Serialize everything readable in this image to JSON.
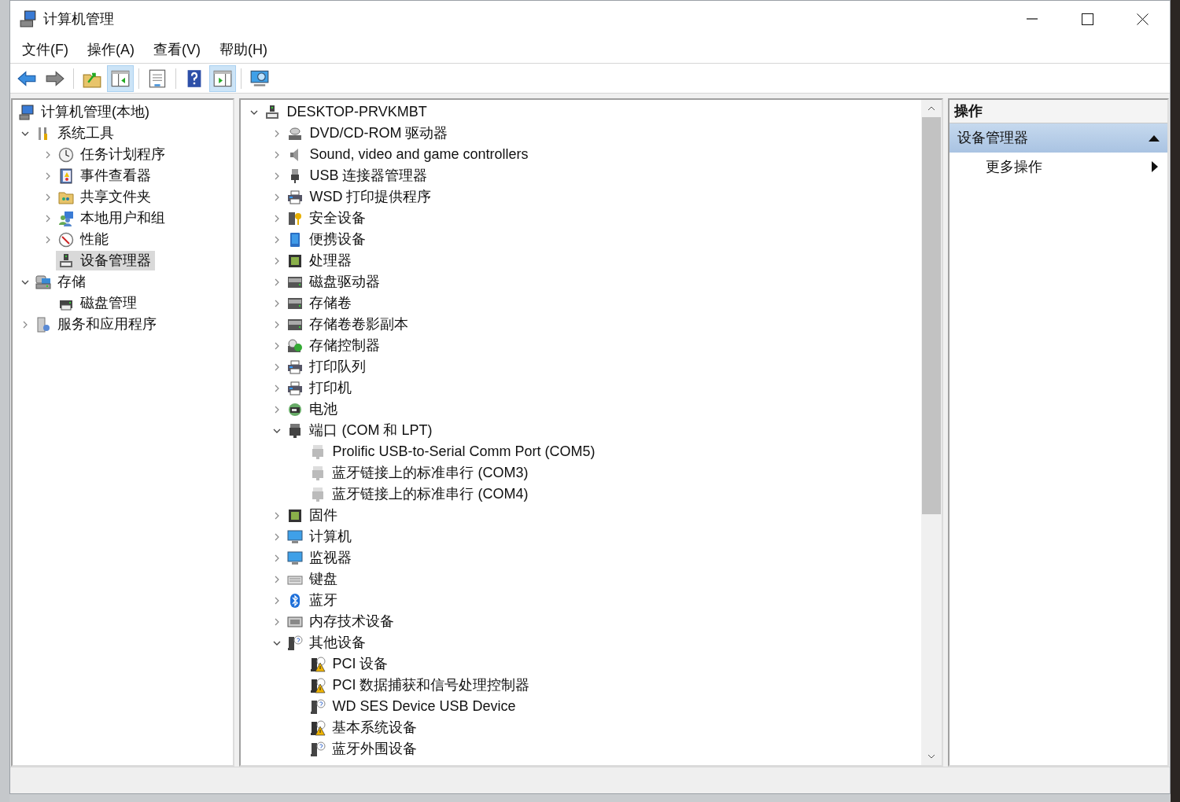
{
  "window": {
    "title": "计算机管理"
  },
  "menu": [
    "文件(F)",
    "操作(A)",
    "查看(V)",
    "帮助(H)"
  ],
  "toolbar": [
    {
      "kind": "back",
      "pressed": false
    },
    {
      "kind": "forward",
      "pressed": false
    },
    {
      "kind": "sep"
    },
    {
      "kind": "up",
      "pressed": false
    },
    {
      "kind": "tree",
      "pressed": true
    },
    {
      "kind": "sep"
    },
    {
      "kind": "props",
      "pressed": false
    },
    {
      "kind": "sep"
    },
    {
      "kind": "help",
      "pressed": false
    },
    {
      "kind": "actions",
      "pressed": true
    },
    {
      "kind": "sep"
    },
    {
      "kind": "monitor",
      "pressed": false
    }
  ],
  "console_tree": [
    {
      "label": "计算机管理(本地)",
      "kind": "computer",
      "selected": false,
      "children": [
        {
          "label": "系统工具",
          "kind": "tools",
          "expanded": true,
          "selected": false,
          "children": [
            {
              "label": "任务计划程序",
              "kind": "clock",
              "expanded": false,
              "selected": false
            },
            {
              "label": "事件查看器",
              "kind": "log",
              "expanded": false,
              "selected": false
            },
            {
              "label": "共享文件夹",
              "kind": "share",
              "expanded": false,
              "selected": false
            },
            {
              "label": "本地用户和组",
              "kind": "users",
              "expanded": false,
              "selected": false
            },
            {
              "label": "性能",
              "kind": "gauge",
              "expanded": false,
              "selected": false
            },
            {
              "label": "设备管理器",
              "kind": "devmgr",
              "selected": true
            }
          ]
        },
        {
          "label": "存储",
          "kind": "storage",
          "expanded": true,
          "selected": false,
          "children": [
            {
              "label": "磁盘管理",
              "kind": "disk",
              "selected": false
            }
          ]
        },
        {
          "label": "服务和应用程序",
          "kind": "services",
          "expanded": false,
          "selected": false
        }
      ]
    }
  ],
  "device_tree": [
    {
      "label": "DESKTOP-PRVKMBT",
      "kind": "devmgr",
      "expanded": true,
      "children": [
        {
          "label": "DVD/CD-ROM 驱动器",
          "kind": "dvd",
          "expanded": false
        },
        {
          "label": "Sound, video and game controllers",
          "kind": "sound",
          "expanded": false
        },
        {
          "label": "USB 连接器管理器",
          "kind": "usb",
          "expanded": false
        },
        {
          "label": "WSD 打印提供程序",
          "kind": "printer",
          "expanded": false
        },
        {
          "label": "安全设备",
          "kind": "security",
          "expanded": false
        },
        {
          "label": "便携设备",
          "kind": "portable",
          "expanded": false
        },
        {
          "label": "处理器",
          "kind": "cpu",
          "expanded": false
        },
        {
          "label": "磁盘驱动器",
          "kind": "drive",
          "expanded": false
        },
        {
          "label": "存储卷",
          "kind": "drive",
          "expanded": false
        },
        {
          "label": "存储卷卷影副本",
          "kind": "drive",
          "expanded": false
        },
        {
          "label": "存储控制器",
          "kind": "controller",
          "expanded": false
        },
        {
          "label": "打印队列",
          "kind": "printer",
          "expanded": false
        },
        {
          "label": "打印机",
          "kind": "printer",
          "expanded": false
        },
        {
          "label": "电池",
          "kind": "battery",
          "expanded": false
        },
        {
          "label": "端口 (COM 和 LPT)",
          "kind": "port",
          "expanded": true,
          "children": [
            {
              "label": "Prolific USB-to-Serial Comm Port (COM5)",
              "kind": "portdev"
            },
            {
              "label": "蓝牙链接上的标准串行 (COM3)",
              "kind": "portdev"
            },
            {
              "label": "蓝牙链接上的标准串行 (COM4)",
              "kind": "portdev"
            }
          ]
        },
        {
          "label": "固件",
          "kind": "cpu",
          "expanded": false
        },
        {
          "label": "计算机",
          "kind": "monitor",
          "expanded": false
        },
        {
          "label": "监视器",
          "kind": "monitor",
          "expanded": false
        },
        {
          "label": "键盘",
          "kind": "keyboard",
          "expanded": false
        },
        {
          "label": "蓝牙",
          "kind": "bluetooth",
          "expanded": false
        },
        {
          "label": "内存技术设备",
          "kind": "memory",
          "expanded": false
        },
        {
          "label": "其他设备",
          "kind": "unknown",
          "expanded": true,
          "children": [
            {
              "label": "PCI 设备",
              "kind": "warning"
            },
            {
              "label": "PCI 数据捕获和信号处理控制器",
              "kind": "warning"
            },
            {
              "label": "WD SES Device USB Device",
              "kind": "unknown"
            },
            {
              "label": "基本系统设备",
              "kind": "warning"
            },
            {
              "label": "蓝牙外围设备",
              "kind": "unknown"
            }
          ]
        }
      ]
    }
  ],
  "actions": {
    "header": "操作",
    "section": {
      "label": "设备管理器",
      "expanded": true
    },
    "items": [
      {
        "label": "更多操作"
      }
    ]
  }
}
